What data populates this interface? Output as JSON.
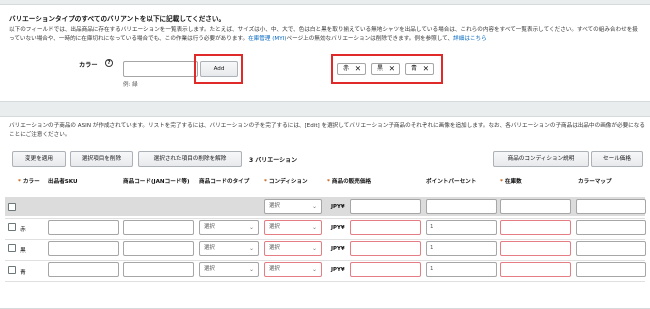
{
  "section1": {
    "title": "バリエーションタイプのすべてのバリアントを以下に記載してください。",
    "description": "以下のフィールドでは、出品商品に存在するバリエーションを一覧表示します。たとえば、サイズは小、中、大で、色は白と黒を取り揃えている無地シャツを出品している場合は、これらの内容をすべて一覧表示してください。すべての組み合わせを扱っていない場合や、一時的に在庫切れになっている場合でも、この作業は行う必要があります。",
    "link_text": "在庫管理 (MYI)",
    "description_tail": "ページ上の無効なバリエーションは削除できます。例を参照して、",
    "detail_link": "詳細はこちら",
    "color_label": "カラー",
    "help_icon": "?",
    "color_input_value": "",
    "example_hint": "例: 緑",
    "add_label": "Add",
    "chips": [
      {
        "label": "赤",
        "remove": "✕"
      },
      {
        "label": "黒",
        "remove": "✕"
      },
      {
        "label": "青",
        "remove": "✕"
      }
    ]
  },
  "section2": {
    "description": "バリエーションの子商品の ASIN が作成されています。リストを完了するには、バリエーションの子を完了するには、[Edit] を選択してバリエーション子商品のそれぞれに画像を追加します。なお、各バリエーションの子商品は出品中の画像が必要になることにご注意ください。",
    "buttons": {
      "apply": "変更を適用",
      "delete_selected": "選択項目を削除",
      "undo_delete": "選択された項目の削除を解除",
      "condition_note": "商品のコンディション説明",
      "sale_price": "セール価格"
    },
    "variation_count": "3 バリエーション",
    "headers": {
      "color": "カラー",
      "seller_sku": "出品者SKU",
      "product_code": "商品コード(JANコード等)",
      "code_type": "商品コードのタイプ",
      "condition": "コンディション",
      "price": "商品の販売価格",
      "points": "ポイントパーセント",
      "stock": "在庫数",
      "color_map": "カラーマップ",
      "required_mark": "*"
    },
    "filter_row": {
      "condition": "選択",
      "currency": "JPY¥",
      "chevron": "⌄"
    },
    "rows": [
      {
        "color": "赤",
        "code_type": "選択",
        "condition": "選択",
        "currency": "JPY¥",
        "points": "1"
      },
      {
        "color": "黒",
        "code_type": "選択",
        "condition": "選択",
        "currency": "JPY¥",
        "points": "1"
      },
      {
        "color": "青",
        "code_type": "選択",
        "condition": "選択",
        "currency": "JPY¥",
        "points": "1"
      }
    ]
  },
  "colors": {
    "highlight": "#e02a2a",
    "link": "#0066c0",
    "required": "#c45500",
    "error_border": "#e47d84"
  }
}
